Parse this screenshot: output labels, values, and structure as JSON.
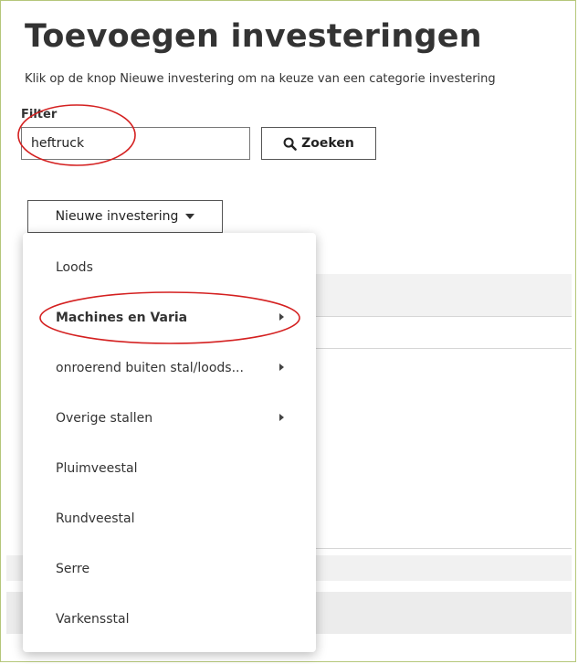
{
  "page": {
    "title": "Toevoegen investeringen",
    "intro": "Klik op de knop Nieuwe investering om na keuze van een categorie investering"
  },
  "filter": {
    "label": "Filter",
    "value": "heftruck",
    "search_button": "Zoeken",
    "search_icon": "search-icon"
  },
  "new_investment": {
    "label": "Nieuwe investering",
    "icon": "caret-down-icon"
  },
  "menu": {
    "items": [
      {
        "label": "Loods",
        "has_submenu": false,
        "bold": false
      },
      {
        "label": "Machines en Varia",
        "has_submenu": true,
        "bold": true
      },
      {
        "label": "onroerend buiten stal/loods...",
        "has_submenu": true,
        "bold": false
      },
      {
        "label": "Overige stallen",
        "has_submenu": true,
        "bold": false
      },
      {
        "label": "Pluimveestal",
        "has_submenu": false,
        "bold": false
      },
      {
        "label": "Rundveestal",
        "has_submenu": false,
        "bold": false
      },
      {
        "label": "Serre",
        "has_submenu": false,
        "bold": false
      },
      {
        "label": "Varkensstal",
        "has_submenu": false,
        "bold": false
      }
    ]
  },
  "colors": {
    "annotation": "#d42020",
    "frame_border": "#b5c77a",
    "text": "#333333"
  }
}
